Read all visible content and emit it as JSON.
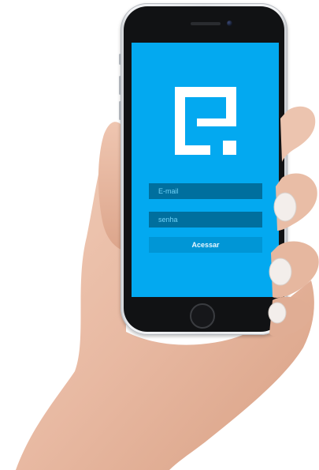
{
  "login": {
    "email_placeholder": "E-mail",
    "password_placeholder": "senha",
    "submit_label": "Acessar"
  },
  "colors": {
    "screen_background": "#03a9f0",
    "input_background": "#006f9e",
    "button_background": "#0096d6",
    "logo_color": "#ffffff"
  },
  "icons": {
    "logo": "e-logo-icon",
    "home": "home-button-icon",
    "camera": "front-camera-icon",
    "speaker": "speaker-grille-icon"
  }
}
